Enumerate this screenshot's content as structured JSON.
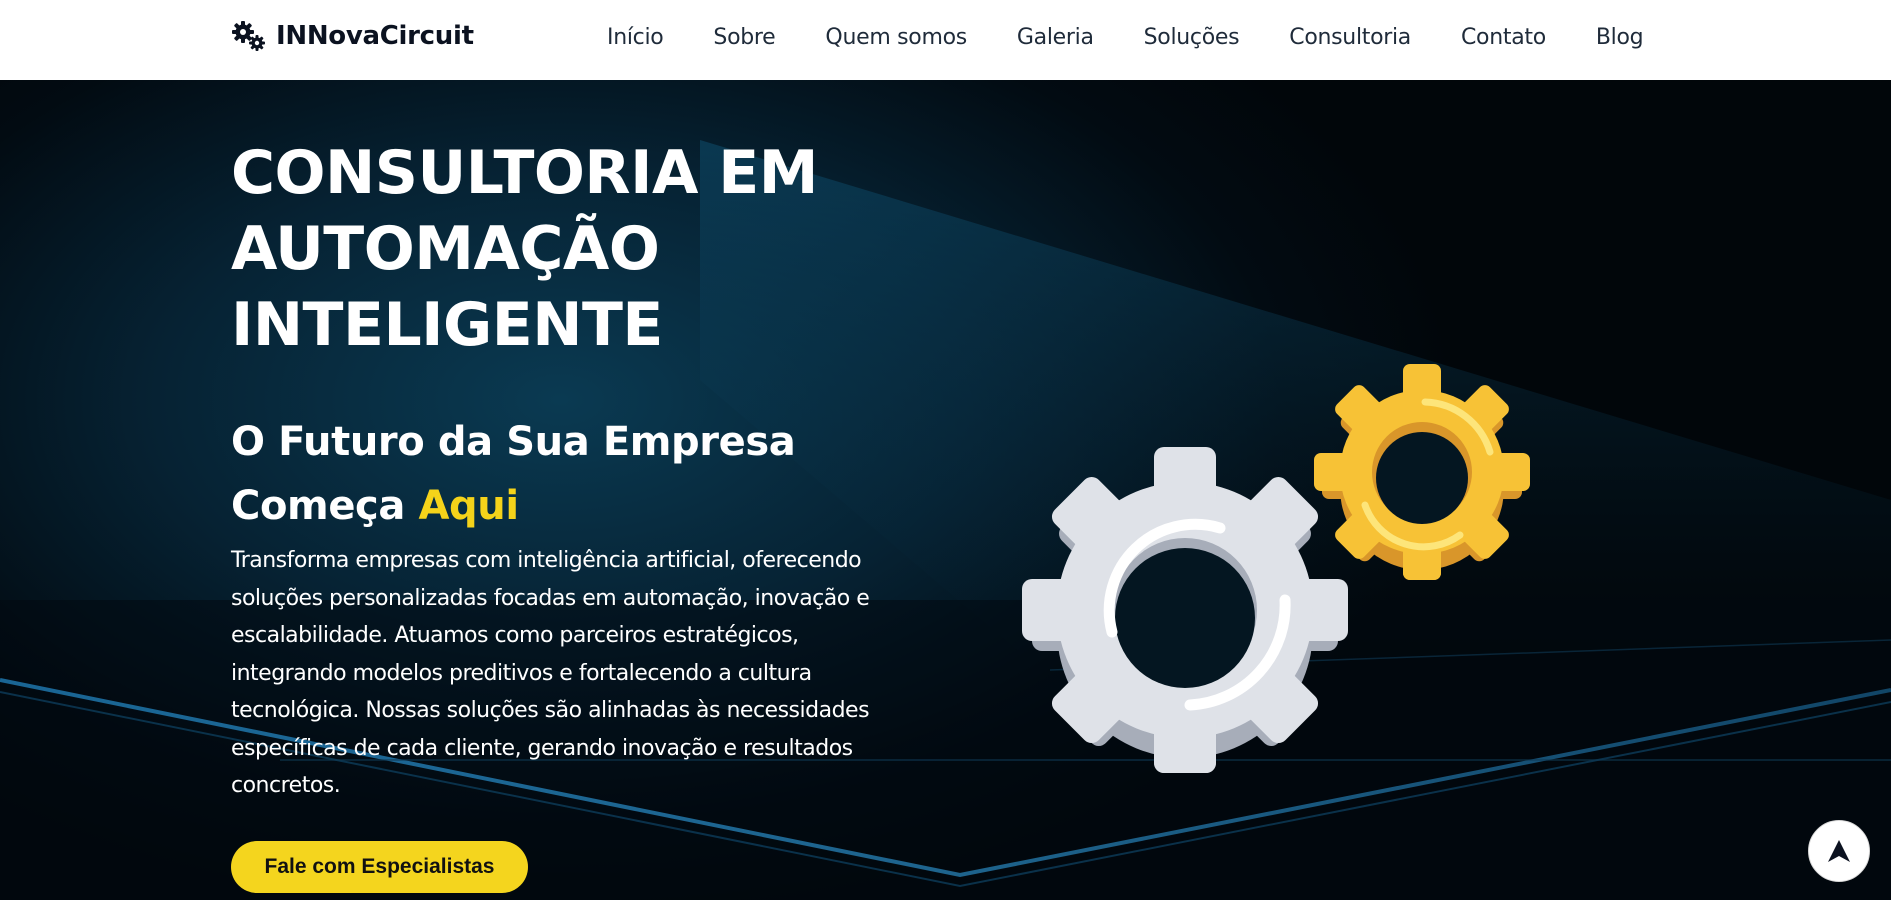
{
  "brand": {
    "name": "INNovaCircuit",
    "logo_icon": "gears-icon",
    "text_color": "#0b1220"
  },
  "nav": {
    "items": [
      {
        "label": "Início"
      },
      {
        "label": "Sobre"
      },
      {
        "label": "Quem somos"
      },
      {
        "label": "Galeria"
      },
      {
        "label": "Soluções"
      },
      {
        "label": "Consultoria"
      },
      {
        "label": "Contato"
      },
      {
        "label": "Blog"
      }
    ]
  },
  "hero": {
    "title_lines": [
      "CONSULTORIA EM",
      "AUTOMAÇÃO",
      "INTELIGENTE"
    ],
    "subtitle_line1": "O Futuro da Sua Empresa",
    "subtitle_line2": "Começa",
    "subtitle_accent": "Aqui",
    "description": "Transforma empresas com inteligência artificial, oferecendo soluções personalizadas focadas em automação, inovação e escalabilidade. Atuamos como parceiros estratégicos, integrando modelos preditivos e fortalecendo a cultura tecnológica. Nossas soluções são alinhadas às necessidades específicas de cada cliente, gerando inovação e resultados concretos.",
    "cta_label": "Fale com Especialistas",
    "illustration": "gears-illustration"
  },
  "scroll_top": {
    "icon": "arrow-up-icon"
  },
  "colors": {
    "accent": "#f5d31a",
    "button": "#f4d51e",
    "background_dark": "#02070c",
    "gear_large": "#dfe2e8",
    "gear_small": "#f7c236"
  }
}
